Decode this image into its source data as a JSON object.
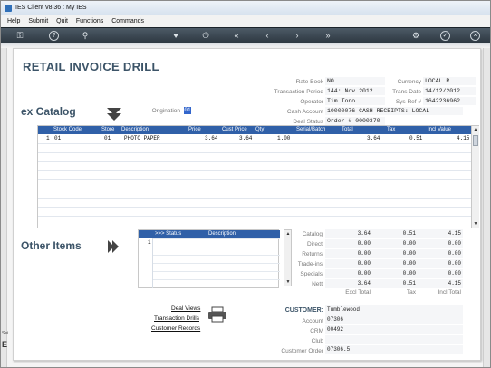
{
  "window": {
    "title": "IES Client v8.36 : My IES"
  },
  "menu": [
    "Help",
    "Submit",
    "Quit",
    "Functions",
    "Commands"
  ],
  "toolbar_icons": [
    "key-icon",
    "help-icon",
    "search-icon",
    "heart-icon",
    "power-icon",
    "rewind-icon",
    "back-icon",
    "forward-icon",
    "fast-forward-icon",
    "settings-icon",
    "check-icon",
    "close-icon"
  ],
  "page": {
    "title": "RETAIL INVOICE  DRILL"
  },
  "header": {
    "rate_book_label": "Rate Book",
    "rate_book": "NO",
    "transaction_period_label": "Transaction Period",
    "transaction_period": "144: Nov 2012",
    "operator_label": "Operator",
    "operator": "Tim Tono",
    "cash_account_label": "Cash Account",
    "cash_account": "10000076 CASH RECEIPTS: LOCAL",
    "deal_status_label": "Deal Status",
    "deal_status": "Order # 0000370",
    "currency_label": "Currency",
    "currency": "LOCAL R",
    "trans_date_label": "Trans Date",
    "trans_date": "14/12/2012",
    "sys_ref_label": "Sys Ref #",
    "sys_ref": "1642236962",
    "origination_label": "Origination",
    "origination": "01"
  },
  "catalog": {
    "title": "ex Catalog",
    "columns": [
      "Stock Code",
      "Store",
      "Description",
      "Price",
      "Cust Price",
      "Qty",
      "Serial/Batch",
      "Total",
      "Tax",
      "Incl Value"
    ],
    "rows": [
      {
        "num": "1",
        "stock_code": "01",
        "store": "01",
        "description": "PHOTO PAPER",
        "price": "3.64",
        "cust_price": "3.64",
        "qty": "1.00",
        "serial": "",
        "total": "3.64",
        "tax": "0.51",
        "incl": "4.15"
      }
    ]
  },
  "other_items": {
    "title": "Other Items",
    "columns": [
      ">>> Status",
      "Description"
    ],
    "row_num": "1"
  },
  "totals": {
    "rows": [
      {
        "label": "Catalog",
        "excl": "3.64",
        "tax": "0.51",
        "incl": "4.15"
      },
      {
        "label": "Direct",
        "excl": "0.00",
        "tax": "0.00",
        "incl": "0.00"
      },
      {
        "label": "Returns",
        "excl": "0.00",
        "tax": "0.00",
        "incl": "0.00"
      },
      {
        "label": "Trade-ins",
        "excl": "0.00",
        "tax": "0.00",
        "incl": "0.00"
      },
      {
        "label": "Specials",
        "excl": "0.00",
        "tax": "0.00",
        "incl": "0.00"
      },
      {
        "label": "Nett",
        "excl": "3.64",
        "tax": "0.51",
        "incl": "4.15"
      }
    ],
    "footer": {
      "excl": "Excl Total",
      "tax": "Tax",
      "incl": "Incl Total"
    }
  },
  "links": {
    "deal_views": "Deal Views",
    "transaction_drills": "Transaction Drills",
    "customer_records": "Customer Records"
  },
  "customer": {
    "label": "CUSTOMER:",
    "name": "Tumblewood",
    "account_label": "Account",
    "account": "07306",
    "crm_label": "CRM",
    "crm": "00492",
    "club_label": "Club",
    "club": "",
    "customer_order_label": "Customer Order",
    "customer_order": "07306.5"
  },
  "left_strip": {
    "text_a": "Sei",
    "text_b": "E"
  }
}
